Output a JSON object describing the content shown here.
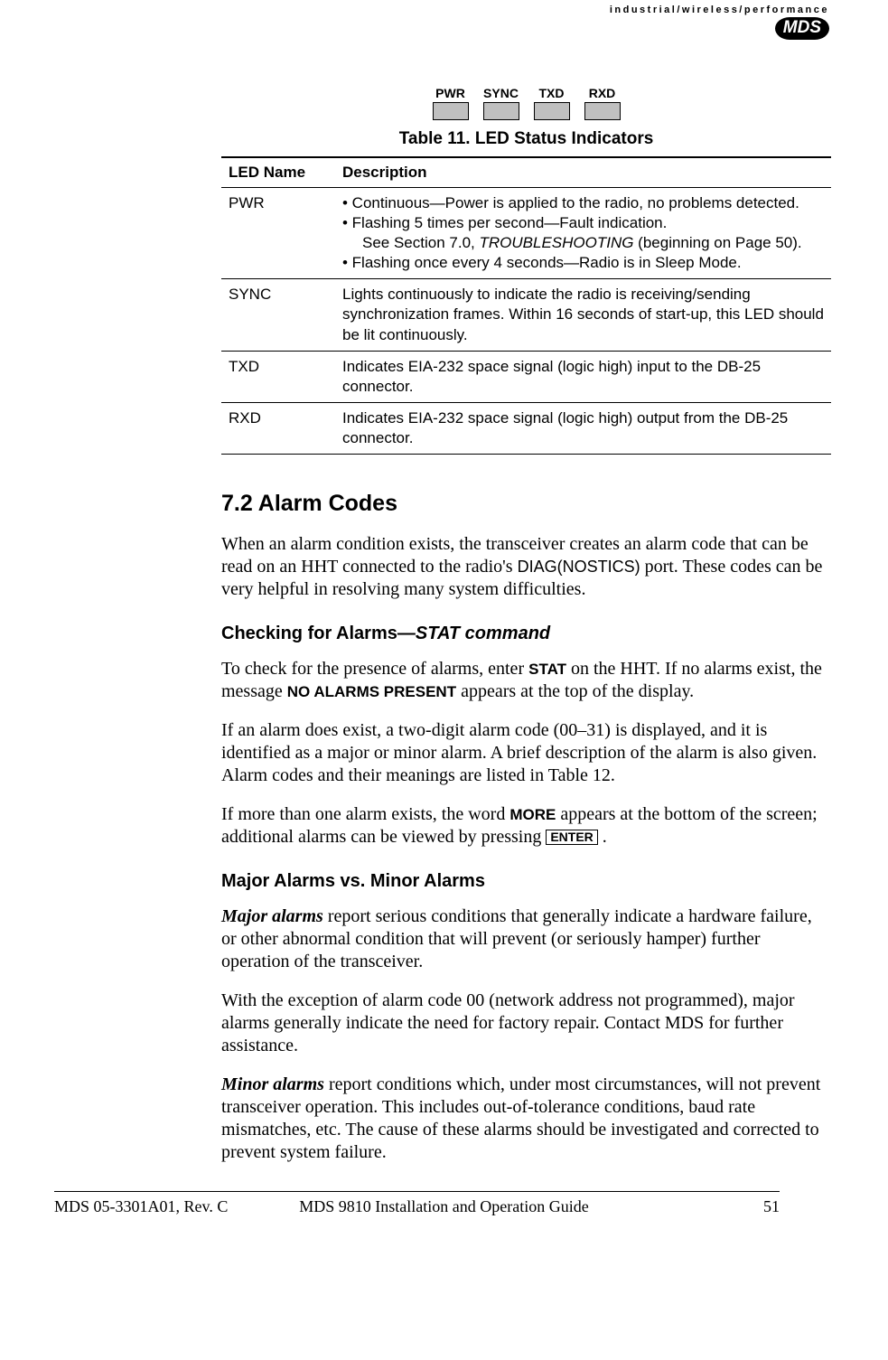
{
  "brand": {
    "tagline": "industrial/wireless/performance",
    "logo_text": "MDS"
  },
  "led_figure": {
    "labels": [
      "PWR",
      "SYNC",
      "TXD",
      "RXD"
    ]
  },
  "table_caption": "Table 11. LED Status Indicators",
  "table_headers": {
    "col1": "LED Name",
    "col2": "Description"
  },
  "table_rows": [
    {
      "name": "PWR",
      "desc_bullets": [
        "• Continuous—Power is applied to the radio, no problems detected.",
        "• Flashing 5 times per second—Fault indication."
      ],
      "desc_sub": "See Section 7.0, ",
      "desc_sub_italic": "TROUBLESHOOTING",
      "desc_sub_tail": " (beginning on Page 50).",
      "desc_bullets2": [
        "• Flashing once every 4 seconds—Radio is in Sleep Mode."
      ]
    },
    {
      "name": "SYNC",
      "desc_plain": "Lights continuously to indicate the radio is receiving/sending synchronization frames. Within 16 seconds of start-up, this LED should be lit continuously."
    },
    {
      "name": "TXD",
      "desc_plain": "Indicates EIA-232 space signal (logic high) input to the DB-25 connector."
    },
    {
      "name": "RXD",
      "desc_plain": "Indicates EIA-232 space signal (logic high) output from the DB-25 connector."
    }
  ],
  "section_7_2": {
    "title": "7.2   Alarm Codes",
    "intro_pre": "When an alarm condition exists, the transceiver creates an alarm code that can be read on an HHT connected to the radio's ",
    "intro_code": "DIAG(NOSTICS)",
    "intro_post": " port. These codes can be very helpful in resolving many system difficul­ties."
  },
  "checking_alarms": {
    "title_plain": "Checking for Alarms—",
    "title_ital": "STAT command",
    "p1_a": "To check for the presence of alarms, enter ",
    "p1_b": "STAT",
    "p1_c": " on the HHT. If no alarms exist, the message ",
    "p1_d": "NO ALARMS PRESENT",
    "p1_e": " appears at the top of the display.",
    "p2": "If an alarm does exist, a two-digit alarm code (00–31) is displayed, and it is identified as a major or minor alarm. A brief description of the alarm is also given. Alarm codes and their meanings are listed in Table 12.",
    "p3_a": "If more than one alarm exists, the word ",
    "p3_b": "MORE",
    "p3_c": " appears at the bottom of the screen; additional alarms can be viewed by pressing ",
    "p3_key": "ENTER",
    "p3_d": " ."
  },
  "major_minor": {
    "title": "Major Alarms vs. Minor Alarms",
    "p1_term": "Major alarms",
    "p1_text": " report serious conditions that generally indicate a hard­ware failure, or other abnormal condition that will prevent (or seriously hamper) further operation of the transceiver.",
    "p2": "With the exception of alarm code 00 (network address not pro­grammed), major alarms generally indicate the need for factory repair. Contact MDS for further assistance.",
    "p3_term": "Minor alarms",
    "p3_text": " report conditions which, under most circumstances, will not prevent transceiver operation. This includes out-of-tolerance condi­tions, baud rate mismatches, etc. The cause of these alarms should be investigated and corrected to prevent system failure."
  },
  "footer": {
    "left": "MDS 05-3301A01, Rev. C",
    "center": "MDS 9810 Installation and Operation Guide",
    "right": "51"
  }
}
